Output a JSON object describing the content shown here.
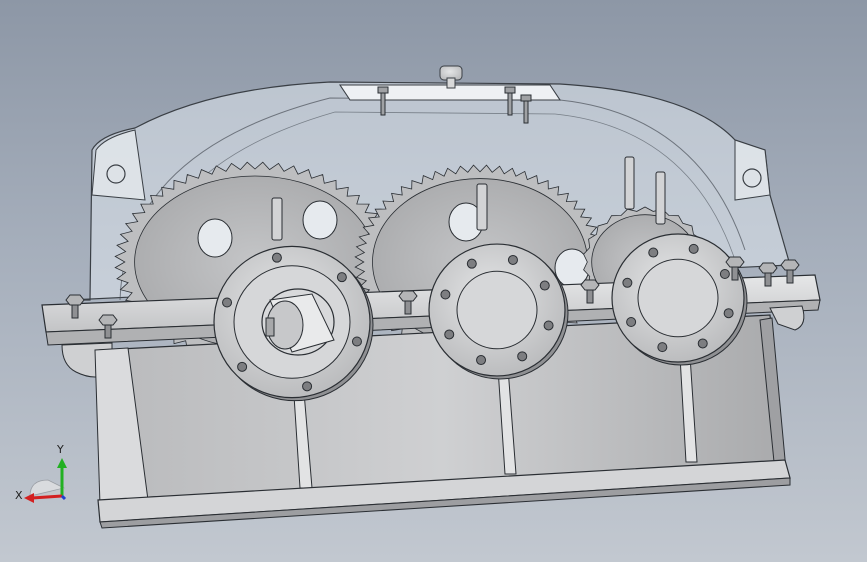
{
  "viewport": {
    "background_top": "#8d97a6",
    "background_bottom": "#c2c8d0"
  },
  "model": {
    "shells": {
      "outline": "#2a2e33",
      "metal": "#c9cacc",
      "cover": "#dde3ea"
    },
    "gears": [
      {
        "name": "large-gear-left",
        "teeth": 56
      },
      {
        "name": "large-gear-center",
        "teeth": 60
      },
      {
        "name": "small-gear-right",
        "teeth": 22
      }
    ]
  },
  "triad": {
    "x_label": "X",
    "y_label": "Y",
    "colors": {
      "x": "#d32020",
      "y": "#22b022",
      "z": "#2040d0"
    }
  }
}
